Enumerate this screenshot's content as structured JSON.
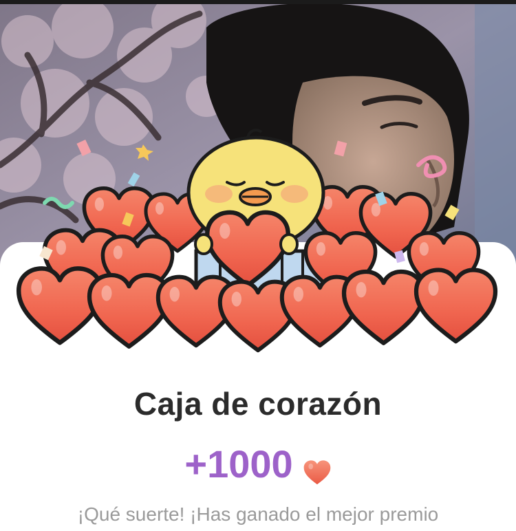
{
  "reward_card": {
    "title": "Caja de corazón",
    "amount": "+1000",
    "currency_icon": "heart-icon",
    "message": "¡Qué suerte! ¡Has ganado el mejor premio"
  },
  "colors": {
    "title": "#2b2b2b",
    "amount": "#9d62c9",
    "message": "#9a9a9a",
    "heart": "#f0654f",
    "chick": "#f6e27a"
  }
}
